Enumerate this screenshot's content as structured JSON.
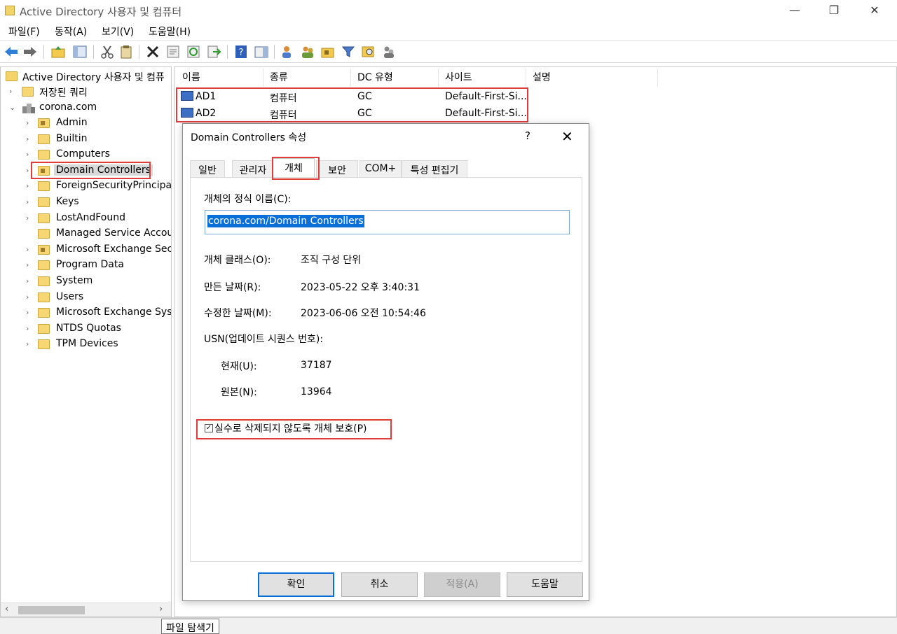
{
  "window": {
    "title": "Active Directory 사용자 및 컴퓨터",
    "minimize": "—",
    "maximize": "❐",
    "close": "✕"
  },
  "menu": [
    "파일(F)",
    "동작(A)",
    "보기(V)",
    "도움말(H)"
  ],
  "tree": {
    "root": "Active Directory 사용자 및 컴퓨",
    "saved_queries": "저장된 쿼리",
    "domain": "corona.com",
    "items": [
      "Admin",
      "Builtin",
      "Computers",
      "Domain Controllers",
      "ForeignSecurityPrincipals",
      "Keys",
      "LostAndFound",
      "Managed Service Accour",
      "Microsoft Exchange Secu",
      "Program Data",
      "System",
      "Users",
      "Microsoft Exchange Syste",
      "NTDS Quotas",
      "TPM Devices"
    ],
    "selected": "Domain Controllers"
  },
  "list": {
    "columns": [
      "이름",
      "종류",
      "DC 유형",
      "사이트",
      "설명"
    ],
    "rows": [
      {
        "name": "AD1",
        "type": "컴퓨터",
        "dc_type": "GC",
        "site": "Default-First-Si...",
        "desc": ""
      },
      {
        "name": "AD2",
        "type": "컴퓨터",
        "dc_type": "GC",
        "site": "Default-First-Si...",
        "desc": ""
      }
    ]
  },
  "dialog": {
    "title": "Domain Controllers 속성",
    "help": "?",
    "close": "✕",
    "tabs": [
      "일반",
      "관리자",
      "개체",
      "보안",
      "COM+",
      "특성 편집기"
    ],
    "active_tab": "개체",
    "canonical_name_label": "개체의 정식 이름(C):",
    "canonical_name_value": "corona.com/Domain Controllers",
    "object_class_label": "개체 클래스(O):",
    "object_class_value": "조직 구성 단위",
    "created_label": "만든 날짜(R):",
    "created_value": "2023-05-22 오후 3:40:31",
    "modified_label": "수정한 날짜(M):",
    "modified_value": "2023-06-06 오전 10:54:46",
    "usn_label": "USN(업데이트 시퀀스 번호):",
    "current_label": "현재(U):",
    "current_value": "37187",
    "original_label": "원본(N):",
    "original_value": "13964",
    "protect_label": "실수로 삭제되지 않도록 개체 보호(P)",
    "protect_checked": true,
    "buttons": {
      "ok": "확인",
      "cancel": "취소",
      "apply": "적용(A)",
      "help": "도움말"
    }
  },
  "statusbar": {
    "tooltip": "파일 탐색기"
  },
  "colors": {
    "highlight": "#e03c3c",
    "selection": "#0a6fd8"
  }
}
